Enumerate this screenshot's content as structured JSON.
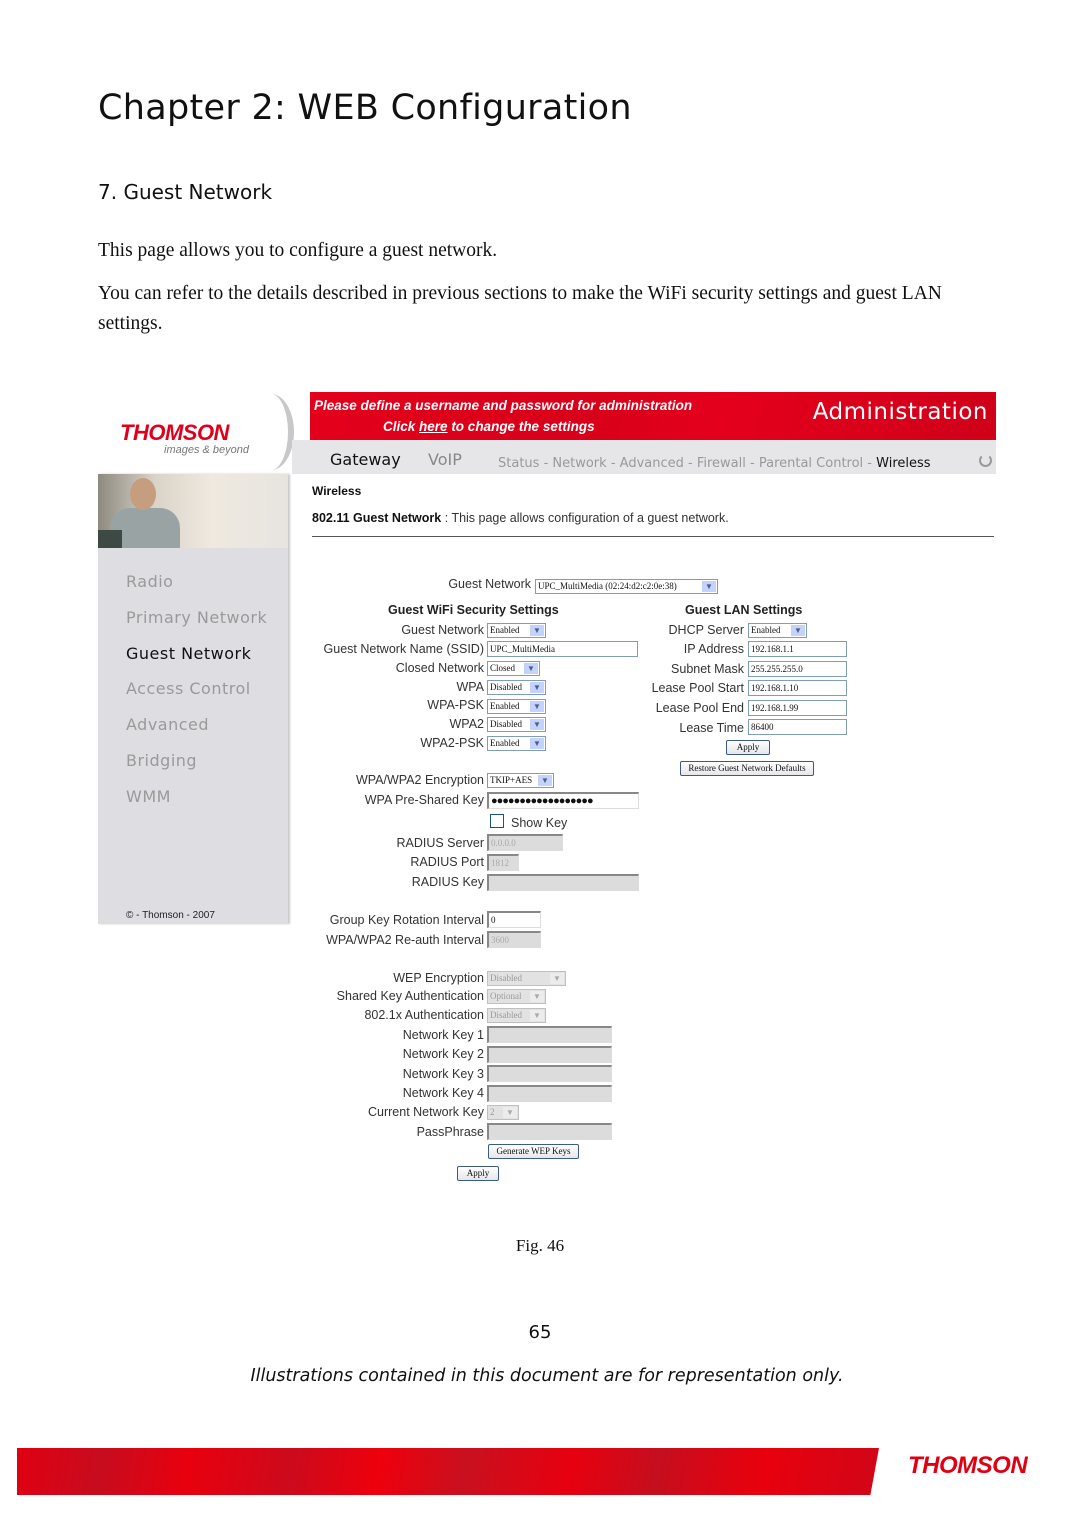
{
  "document": {
    "chapter_title": "Chapter 2: WEB Configuration",
    "section_title": "7. Guest Network",
    "paragraph1": "This page allows you to configure a guest network.",
    "paragraph2": "You can refer to the details described in previous sections to make the WiFi security settings and guest LAN settings.",
    "figure_caption": "Fig. 46",
    "page_number": "65",
    "disclaimer": "Illustrations contained in this document are for representation only.",
    "footer_logo": "THOMSON"
  },
  "router_ui": {
    "logo": {
      "brand": "THOMSON",
      "tagline": "images & beyond"
    },
    "banner": {
      "line1": "Please define a username and password for administration",
      "line2_prefix": "Click ",
      "line2_link": "here",
      "line2_suffix": " to change the settings",
      "title": "Administration"
    },
    "top_nav": {
      "primary": [
        "Gateway",
        "VoIP"
      ],
      "secondary": [
        "Status",
        "Network",
        "Advanced",
        "Firewall",
        "Parental Control",
        "Wireless"
      ],
      "active_secondary": "Wireless",
      "separator": " - "
    },
    "sidebar": {
      "items": [
        {
          "label": "Radio",
          "active": false
        },
        {
          "label": "Primary Network",
          "active": false
        },
        {
          "label": "Guest Network",
          "active": true
        },
        {
          "label": "Access Control",
          "active": false
        },
        {
          "label": "Advanced",
          "active": false
        },
        {
          "label": "Bridging",
          "active": false
        },
        {
          "label": "WMM",
          "active": false
        }
      ],
      "copyright": "© - Thomson - 2007"
    },
    "breadcrumb": "Wireless",
    "page_heading": "802.11 Guest Network",
    "page_heading_sep": " : ",
    "page_description": "This page allows configuration of a guest network.",
    "guest_network_select": {
      "label": "Guest Network",
      "value": "UPC_MultiMedia (02:24:d2:c2:0e:38)"
    },
    "security": {
      "header": "Guest WiFi Security Settings",
      "guest_network": {
        "label": "Guest Network",
        "value": "Enabled"
      },
      "ssid": {
        "label": "Guest Network Name (SSID)",
        "value": "UPC_MultiMedia"
      },
      "closed_network": {
        "label": "Closed Network",
        "value": "Closed"
      },
      "wpa": {
        "label": "WPA",
        "value": "Disabled"
      },
      "wpa_psk": {
        "label": "WPA-PSK",
        "value": "Enabled"
      },
      "wpa2": {
        "label": "WPA2",
        "value": "Disabled"
      },
      "wpa2_psk": {
        "label": "WPA2-PSK",
        "value": "Enabled"
      },
      "encryption": {
        "label": "WPA/WPA2 Encryption",
        "value": "TKIP+AES"
      },
      "psk": {
        "label": "WPA Pre-Shared Key",
        "value": "●●●●●●●●●●●●●●●●●●"
      },
      "show_key": {
        "label": "Show Key",
        "checked": false
      },
      "radius_server": {
        "label": "RADIUS Server",
        "value": "0.0.0.0"
      },
      "radius_port": {
        "label": "RADIUS Port",
        "value": "1812"
      },
      "radius_key": {
        "label": "RADIUS Key",
        "value": ""
      },
      "group_key_interval": {
        "label": "Group Key Rotation Interval",
        "value": "0"
      },
      "reauth_interval": {
        "label": "WPA/WPA2 Re-auth Interval",
        "value": "3600"
      },
      "wep_encryption": {
        "label": "WEP Encryption",
        "value": "Disabled"
      },
      "shared_key_auth": {
        "label": "Shared Key Authentication",
        "value": "Optional"
      },
      "dot1x_auth": {
        "label": "802.1x Authentication",
        "value": "Disabled"
      },
      "network_key1": {
        "label": "Network Key 1",
        "value": ""
      },
      "network_key2": {
        "label": "Network Key 2",
        "value": ""
      },
      "network_key3": {
        "label": "Network Key 3",
        "value": ""
      },
      "network_key4": {
        "label": "Network Key 4",
        "value": ""
      },
      "current_key": {
        "label": "Current Network Key",
        "value": "2"
      },
      "passphrase": {
        "label": "PassPhrase",
        "value": ""
      },
      "generate_button": "Generate WEP Keys",
      "apply_button": "Apply"
    },
    "lan": {
      "header": "Guest LAN Settings",
      "dhcp_server": {
        "label": "DHCP Server",
        "value": "Enabled"
      },
      "ip_address": {
        "label": "IP Address",
        "value": "192.168.1.1"
      },
      "subnet_mask": {
        "label": "Subnet Mask",
        "value": "255.255.255.0"
      },
      "lease_start": {
        "label": "Lease Pool Start",
        "value": "192.168.1.10"
      },
      "lease_end": {
        "label": "Lease Pool End",
        "value": "192.168.1.99"
      },
      "lease_time": {
        "label": "Lease Time",
        "value": "86400"
      },
      "apply_button": "Apply",
      "restore_button": "Restore Guest Network Defaults"
    }
  }
}
